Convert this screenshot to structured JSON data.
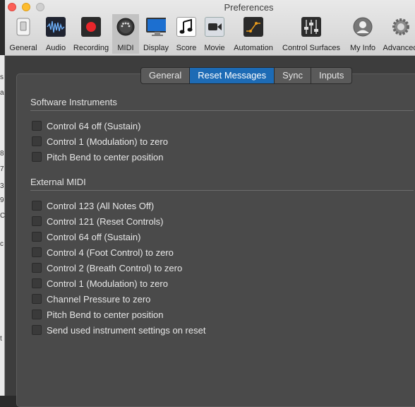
{
  "window": {
    "title": "Preferences"
  },
  "toolbar": {
    "items": [
      {
        "label": "General",
        "icon": "general-icon",
        "selected": false
      },
      {
        "label": "Audio",
        "icon": "audio-icon",
        "selected": false
      },
      {
        "label": "Recording",
        "icon": "recording-icon",
        "selected": false
      },
      {
        "label": "MIDI",
        "icon": "midi-icon",
        "selected": true
      },
      {
        "label": "Display",
        "icon": "display-icon",
        "selected": false
      },
      {
        "label": "Score",
        "icon": "score-icon",
        "selected": false
      },
      {
        "label": "Movie",
        "icon": "movie-icon",
        "selected": false
      },
      {
        "label": "Automation",
        "icon": "automation-icon",
        "selected": false
      },
      {
        "label": "Control Surfaces",
        "icon": "control-surfaces-icon",
        "selected": false
      },
      {
        "label": "My Info",
        "icon": "my-info-icon",
        "selected": false
      },
      {
        "label": "Advanced",
        "icon": "advanced-icon",
        "selected": false
      }
    ]
  },
  "tabs": [
    {
      "label": "General",
      "selected": false
    },
    {
      "label": "Reset Messages",
      "selected": true
    },
    {
      "label": "Sync",
      "selected": false
    },
    {
      "label": "Inputs",
      "selected": false
    }
  ],
  "software_instruments": {
    "title": "Software Instruments",
    "options": [
      {
        "label": "Control 64 off (Sustain)",
        "checked": false
      },
      {
        "label": "Control 1 (Modulation) to zero",
        "checked": false
      },
      {
        "label": "Pitch Bend to center position",
        "checked": false
      }
    ]
  },
  "external_midi": {
    "title": "External MIDI",
    "options": [
      {
        "label": "Control 123 (All Notes Off)",
        "checked": false
      },
      {
        "label": "Control 121 (Reset Controls)",
        "checked": false
      },
      {
        "label": "Control 64 off (Sustain)",
        "checked": false
      },
      {
        "label": "Control 4 (Foot Control) to zero",
        "checked": false
      },
      {
        "label": "Control 2 (Breath Control) to zero",
        "checked": false
      },
      {
        "label": "Control 1 (Modulation) to zero",
        "checked": false
      },
      {
        "label": "Channel Pressure to zero",
        "checked": false
      },
      {
        "label": "Pitch Bend to center position",
        "checked": false
      },
      {
        "label": "Send used instrument settings on reset",
        "checked": false
      }
    ]
  },
  "colors": {
    "accent": "#1d6bb5",
    "panel": "#4a4a4a",
    "window": "#3d3d3d"
  }
}
